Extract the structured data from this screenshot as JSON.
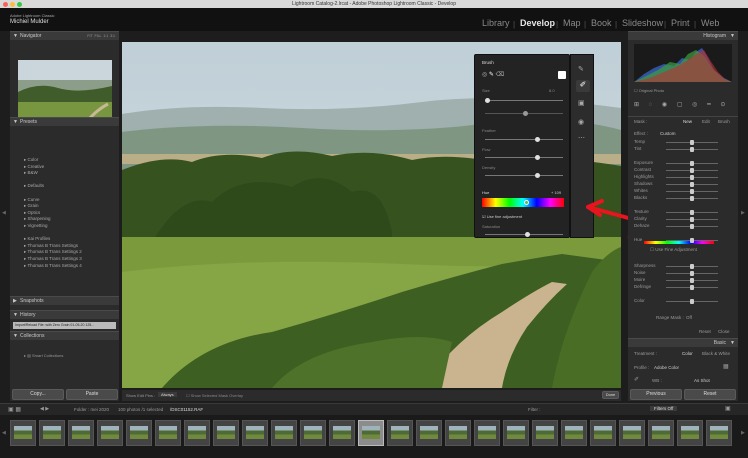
{
  "window": {
    "title": "Lightroom Catalog-2.lrcat - Adobe Photoshop Lightroom Classic - Develop"
  },
  "identity": {
    "company": "Adobe Lightroom Classic",
    "name": "Michiel Mulder"
  },
  "modules": [
    "Library",
    "Develop",
    "Map",
    "Book",
    "Slideshow",
    "Print",
    "Web"
  ],
  "left": {
    "navigator": {
      "title": "Navigator",
      "zoom": [
        "FIT",
        "FILL",
        "1:1",
        "3:1"
      ]
    },
    "presets": {
      "title": "Presets",
      "items": [
        "Color",
        "Creative",
        "B&W",
        "",
        "Defaults",
        "",
        "Curve",
        "Grain",
        "Optics",
        "Sharpening",
        "Vignetting",
        "",
        "Kai Profiles",
        "Thomas B Trans Settings",
        "Thomas B Trans Settings 2",
        "Thomas B Trans Settings 3",
        "Thomas B Trans Settings 4"
      ]
    },
    "snapshots": {
      "title": "Snapshots"
    },
    "history": {
      "title": "History",
      "item": "Import/Reload File: with Zero Grain 01-05-20 125..."
    },
    "collections": {
      "title": "Collections",
      "item": "Smart Collections"
    },
    "copy_label": "Copy...",
    "paste_label": "Paste"
  },
  "toolbar": {
    "show_edit_pins": "Show Edit Pins :",
    "edit_pins_value": "Always",
    "overlay_label": "Show Selected Mask Overlay",
    "done_label": "Done"
  },
  "brush": {
    "title": "Brush",
    "size_label": "Size",
    "size_value": "8.0",
    "feather_label": "Feather",
    "flow_label": "Flow",
    "density_label": "Density",
    "hue_label": "Hue",
    "hue_value": "+ 109",
    "fine_adjust": "Use fine adjustment",
    "saturation_label": "Saturation"
  },
  "right": {
    "histogram": {
      "title": "Histogram",
      "original_photo": "Original Photo"
    },
    "mask_tabs": [
      "Mask :",
      "New",
      "Edit",
      "Brush"
    ],
    "effect": {
      "label": "Effect :",
      "value": "Custom"
    },
    "sliders_a": [
      "Temp",
      "Tint",
      "",
      "Exposure",
      "Contrast",
      "Highlights",
      "Shadows",
      "Whites",
      "Blacks",
      "",
      "Texture",
      "Clarity",
      "Dehaze",
      "",
      "Hue"
    ],
    "fine_adjust": "Use Fine Adjustment",
    "sliders_b": [
      "Sharpness",
      "Noise",
      "Moire",
      "Defringe",
      "",
      "Color"
    ],
    "range_mask": {
      "label": "Range Mask :",
      "value": "Off"
    },
    "reset": "Reset",
    "close": "Close",
    "basic": {
      "title": "Basic",
      "treatment": "Treatment :",
      "color": "Color",
      "bw": "Black & White",
      "profile_label": "Profile :",
      "profile": "Adobe Color",
      "wb_label": "WB :",
      "wb": "As Shot"
    },
    "previous_label": "Previous",
    "reset_label": "Reset"
  },
  "filmstrip": {
    "folder": "Folder : mei 2020",
    "count": "100 photos /1 selected",
    "file": "/DSC01152.RAF",
    "filter": "Filter :",
    "filter_value": "Filters Off",
    "thumbs": [
      "1",
      "2",
      "3",
      "4",
      "5",
      "6",
      "7",
      "8",
      "9",
      "10",
      "11",
      "12",
      "13",
      "14",
      "15",
      "16",
      "17",
      "18",
      "19",
      "20",
      "21",
      "22",
      "23",
      "24",
      "25"
    ]
  },
  "colors": {
    "annotation": "#e8141e",
    "panel": "#2b2b2b",
    "accent": "#e0e0e0"
  }
}
